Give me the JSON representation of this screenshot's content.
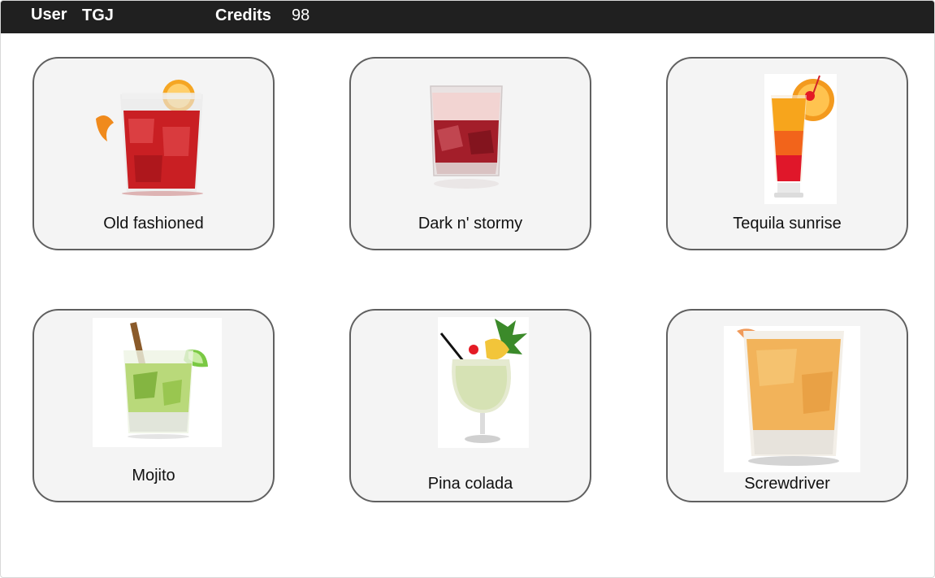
{
  "header": {
    "user_label": "User",
    "user_value": "TGJ",
    "credits_label": "Credits",
    "credits_value": "98"
  },
  "drinks": [
    {
      "name": "Old fashioned",
      "icon": "old-fashioned-glass-icon"
    },
    {
      "name": "Dark n' stormy",
      "icon": "dark-n-stormy-glass-icon"
    },
    {
      "name": "Tequila sunrise",
      "icon": "tequila-sunrise-glass-icon"
    },
    {
      "name": "Mojito",
      "icon": "mojito-glass-icon"
    },
    {
      "name": "Pina colada",
      "icon": "pina-colada-glass-icon"
    },
    {
      "name": "Screwdriver",
      "icon": "screwdriver-glass-icon"
    }
  ],
  "colors": {
    "header_bg": "#202020",
    "card_bg": "#f4f4f4",
    "card_border": "#606060"
  }
}
